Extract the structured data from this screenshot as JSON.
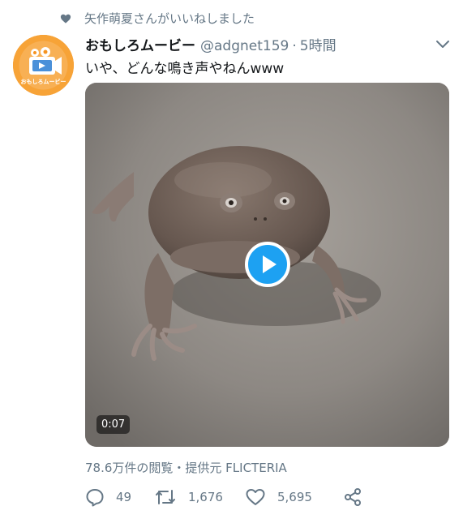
{
  "social_context": {
    "text": "矢作萌夏さんがいいねしました",
    "icon": "heart-icon"
  },
  "author": {
    "display_name": "おもしろムービー",
    "handle": "@adgnet159",
    "separator": "·",
    "time": "5時間",
    "avatar_label": "おもしろムービー",
    "avatar_color": "#f5931f"
  },
  "tweet": {
    "text": "いや、どんな鳴き声やねんwww"
  },
  "media": {
    "duration": "0:07",
    "play_icon": "play-icon",
    "play_color": "#1da1f2"
  },
  "stats": {
    "text": "78.6万件の閲覧・提供元 FLICTERIA"
  },
  "actions": {
    "reply_count": "49",
    "retweet_count": "1,676",
    "like_count": "5,695",
    "icons": [
      "reply-icon",
      "retweet-icon",
      "like-icon",
      "share-icon"
    ]
  }
}
